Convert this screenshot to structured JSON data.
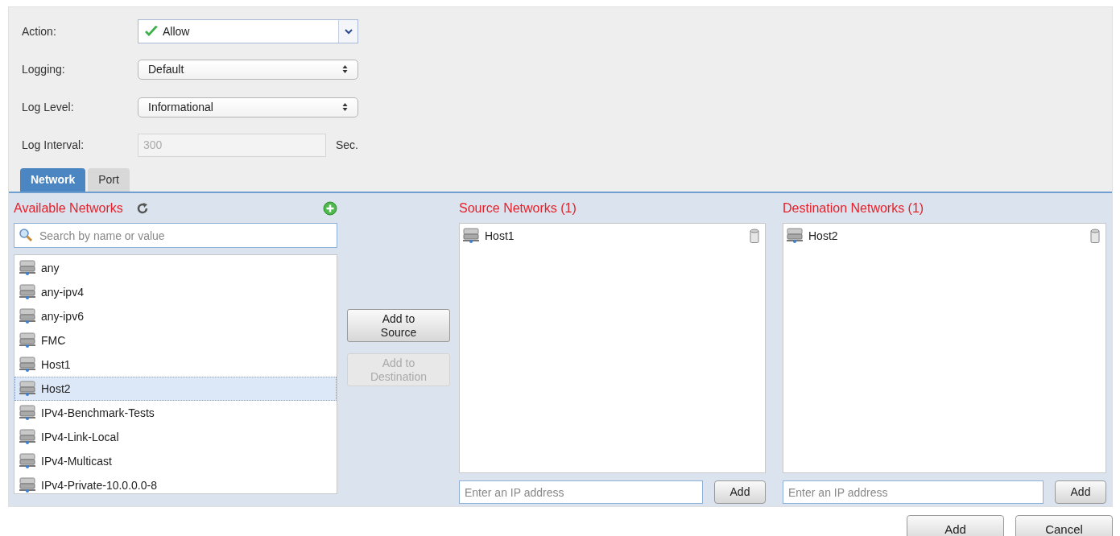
{
  "form": [
    {
      "label": "Action:",
      "kind": "action",
      "value": "Allow"
    },
    {
      "label": "Logging:",
      "kind": "select",
      "value": "Default"
    },
    {
      "label": "Log Level:",
      "kind": "select",
      "value": "Informational"
    },
    {
      "label": "Log Interval:",
      "kind": "disabled_input",
      "value": "300",
      "unit": "Sec."
    }
  ],
  "tabs": [
    {
      "label": "Network",
      "selected": true
    },
    {
      "label": "Port",
      "selected": false
    }
  ],
  "available": {
    "title": "Available Networks",
    "search_placeholder": "Search by name or value",
    "items": [
      {
        "label": "any",
        "selected": false
      },
      {
        "label": "any-ipv4",
        "selected": false
      },
      {
        "label": "any-ipv6",
        "selected": false
      },
      {
        "label": "FMC",
        "selected": false
      },
      {
        "label": "Host1",
        "selected": false
      },
      {
        "label": "Host2",
        "selected": true
      },
      {
        "label": "IPv4-Benchmark-Tests",
        "selected": false
      },
      {
        "label": "IPv4-Link-Local",
        "selected": false
      },
      {
        "label": "IPv4-Multicast",
        "selected": false
      },
      {
        "label": "IPv4-Private-10.0.0.0-8",
        "selected": false
      }
    ]
  },
  "move_buttons": [
    {
      "label": "Add to Source",
      "disabled": false
    },
    {
      "label": "Add to Destination",
      "disabled": true
    }
  ],
  "targets": [
    {
      "title": "Source Networks (1)",
      "items": [
        "Host1"
      ],
      "ip_placeholder": "Enter an IP address",
      "add_label": "Add"
    },
    {
      "title": "Destination Networks (1)",
      "items": [
        "Host2"
      ],
      "ip_placeholder": "Enter an IP address",
      "add_label": "Add"
    }
  ],
  "footer_buttons": [
    "Add",
    "Cancel"
  ]
}
